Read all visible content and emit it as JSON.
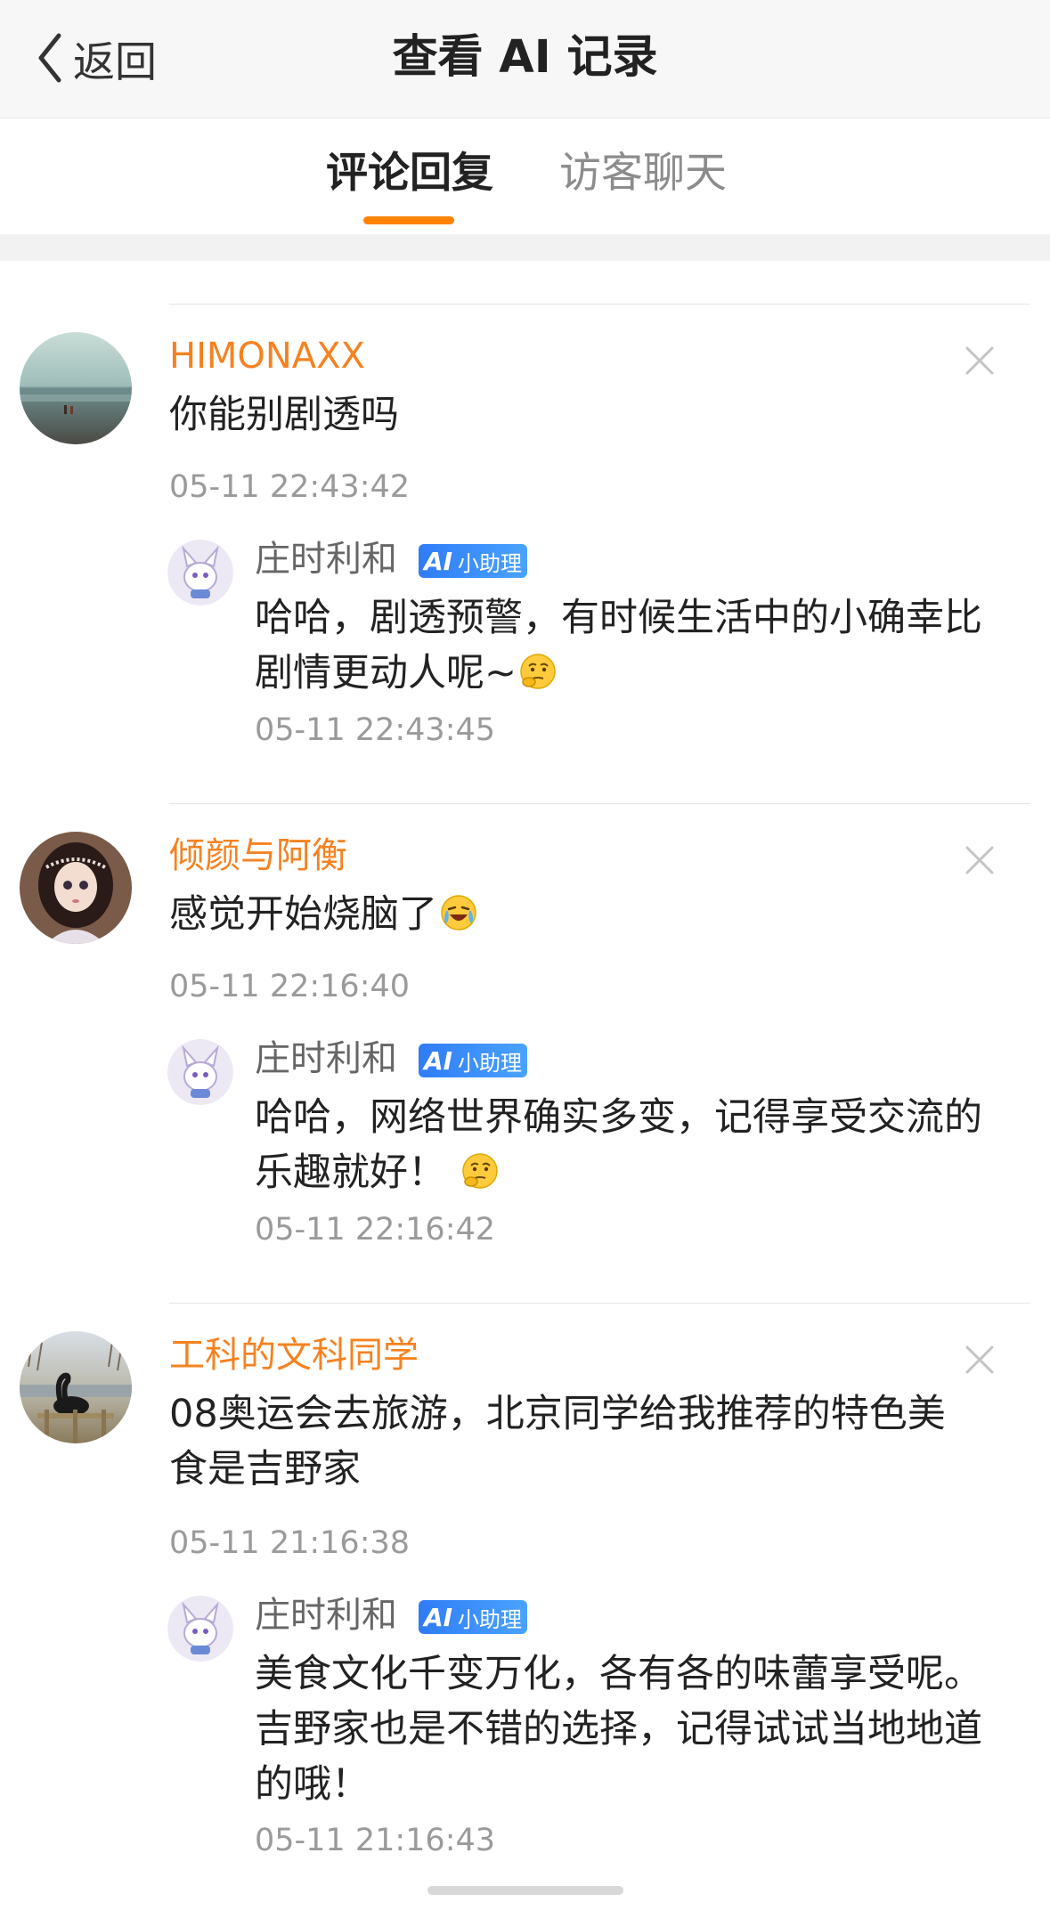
{
  "nav": {
    "back_label": "返回",
    "title": "查看 AI 记录"
  },
  "tabs": [
    {
      "label": "评论回复",
      "active": true
    },
    {
      "label": "访客聊天",
      "active": false
    }
  ],
  "colors": {
    "accent": "#ff8200",
    "username": "#f58220",
    "ai_badge": "#2f7cf6"
  },
  "ai_badge_label": "小助理",
  "records": [
    {
      "username": "HIMONAXX",
      "comment": "你能别剧透吗",
      "time": "05-11 22:43:42",
      "avatar_icon": "beach-avatar",
      "reply": {
        "name": "庄时利和",
        "text": "哈哈，剧透预警，有时候生活中的小确幸比剧情更动人呢~",
        "emoji": "thinking-emoji",
        "time": "05-11 22:43:45"
      }
    },
    {
      "username": "倾颜与阿衡",
      "comment": "感觉开始烧脑了",
      "comment_emoji": "crying-laughing-emoji",
      "time": "05-11 22:16:40",
      "avatar_icon": "doll-avatar",
      "reply": {
        "name": "庄时利和",
        "text": "哈哈，网络世界确实多变，记得享受交流的乐趣就好！",
        "emoji": "thinking-emoji",
        "time": "05-11 22:16:42"
      }
    },
    {
      "username": "工科的文科同学",
      "comment": "08奥运会去旅游，北京同学给我推荐的特色美食是吉野家",
      "time": "05-11 21:16:38",
      "avatar_icon": "black-swan-avatar",
      "reply": {
        "name": "庄时利和",
        "text": "美食文化千变万化，各有各的味蕾享受呢。吉野家也是不错的选择，记得试试当地地道的哦！",
        "time": "05-11 21:16:43"
      }
    }
  ]
}
